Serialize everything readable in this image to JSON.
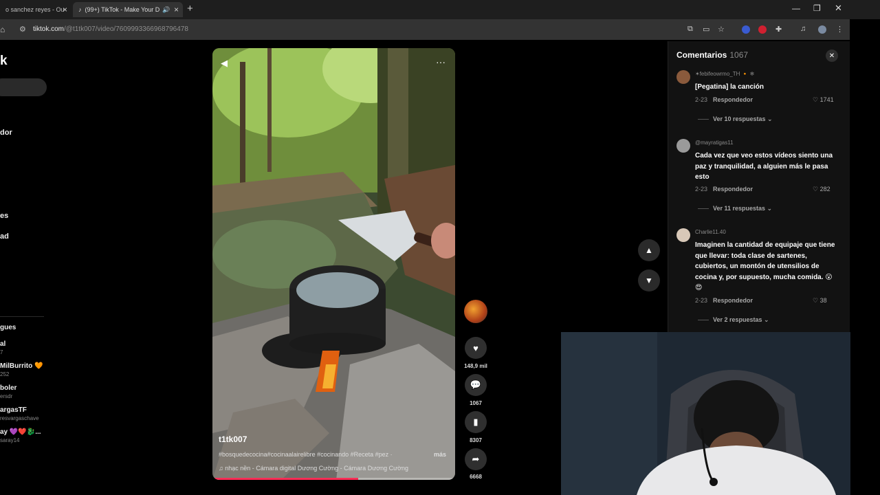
{
  "browser": {
    "tabs": [
      {
        "title": "o sanchez reyes - Ou"
      },
      {
        "title": "(99+) TikTok - Make Your D"
      }
    ],
    "url_host": "tiktok.com",
    "url_path": "/@t1tk007/video/7609993366968796478"
  },
  "sidebar": {
    "logo": "k",
    "items": [
      {
        "label": "dor",
        "top": 0
      },
      {
        "label": "es"
      },
      {
        "label": "ad"
      }
    ],
    "following_header": "gues",
    "following": [
      {
        "name": "al",
        "sub": "7"
      },
      {
        "name": "MilBurrito 🧡",
        "sub": "252"
      },
      {
        "name": "boler",
        "sub": "ersdr"
      },
      {
        "name": "argasTF",
        "sub": "resvargaschave"
      },
      {
        "name": "ay 💜❤️🐉...",
        "sub": "saray14"
      }
    ]
  },
  "video": {
    "author": "t1tk007",
    "description": "#bosquedecocina#cocinaalairelibre #cocinando #Receta #pez ·",
    "more_label": "más",
    "music": "♫  nhạc nền - Cámara digital Dương Cường - Cámara Dương Cường",
    "progress_fraction": 0.6
  },
  "actions": {
    "likes": "148,9 mil",
    "comments": "1067",
    "saves": "8307",
    "shares": "6668"
  },
  "comments_panel": {
    "title": "Comentarios",
    "count": "1067",
    "items": [
      {
        "user": "✶febifeowrmo_TH 🔸 ❄",
        "text": "[Pegatina] la canción",
        "date": "2-23",
        "reply_label": "Respondedor",
        "likes": "1741",
        "replies": "Ver 10 respuestas ⌄",
        "avatar_color": "#8a5a3c"
      },
      {
        "user": "@mayratigas11",
        "text": "Cada vez que veo estos vídeos siento una paz y tranquilidad, a alguien más le pasa esto",
        "date": "2-23",
        "reply_label": "Respondedor",
        "likes": "282",
        "replies": "Ver 11 respuestas ⌄",
        "avatar_color": "#9a9a9a"
      },
      {
        "user": "Charlie11.40",
        "text": "Imaginen la cantidad de equipaje que tiene que llevar: toda clase de sartenes, cubiertos, un montón de utensilios de cocina y, por supuesto, mucha comida. 😮😍",
        "date": "2-23",
        "reply_label": "Respondedor",
        "likes": "38",
        "replies": "Ver 2 respuestas ⌄",
        "avatar_color": "#d8c8b8"
      }
    ]
  },
  "colors": {
    "accent": "#fe2c55",
    "panel_bg": "#121212",
    "chrome_bg": "#333333"
  }
}
